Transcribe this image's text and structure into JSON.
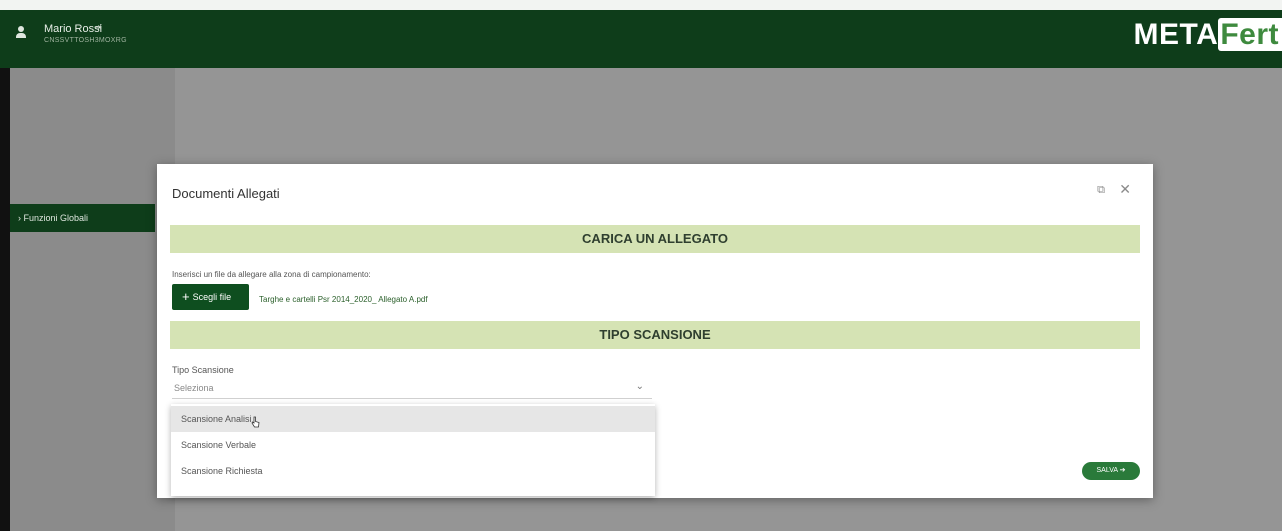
{
  "header": {
    "user_name": "Mario Rossi",
    "user_code": "CNSSVTTOSH3MOXRG",
    "logout_icon": "logout-icon",
    "logo_meta": "META",
    "logo_fert": "Fert"
  },
  "sidebar": {
    "items": [
      {
        "label": "Funzioni Globali",
        "chevron": "›"
      }
    ]
  },
  "modal": {
    "title": "Documenti Allegati",
    "section_upload": "CARICA UN ALLEGATO",
    "upload_hint": "Inserisci un file da allegare alla zona di campionamento:",
    "file_button": "Scegli file",
    "file_name": "Targhe e cartelli Psr 2014_2020_ Allegato A.pdf",
    "section_scan": "TIPO SCANSIONE",
    "scan_label": "Tipo Scansione",
    "scan_value": "Seleziona",
    "options": [
      "Scansione Analisi",
      "Scansione Verbale",
      "Scansione Richiesta"
    ],
    "save_button": "SALVA ➔"
  },
  "colors": {
    "header_bg": "#0e3d1a",
    "section_band": "#d5e3b4",
    "primary_button": "#0e4e1f",
    "save_button": "#2a7a3a"
  }
}
